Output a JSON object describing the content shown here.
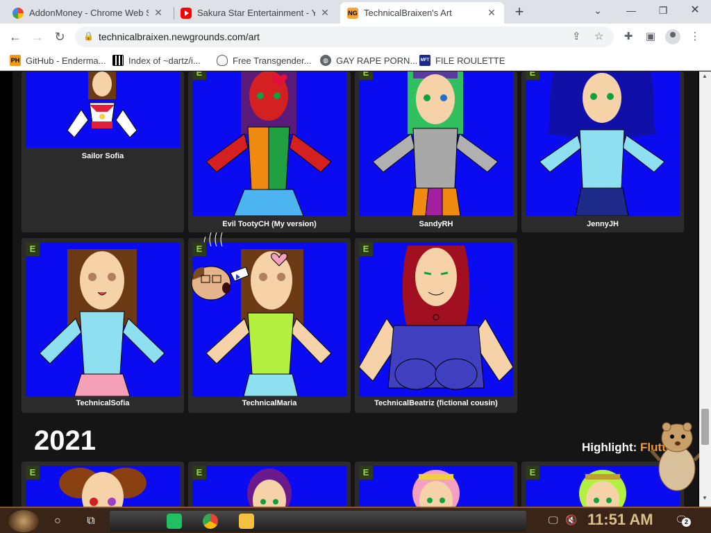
{
  "browser": {
    "tabs": [
      {
        "title": "AddonMoney - Chrome Web St",
        "favicon": "rainbow-icon",
        "active": false
      },
      {
        "title": "Sakura Star Entertainment - Y",
        "favicon": "youtube-icon",
        "active": false
      },
      {
        "title": "TechnicalBraixen's Art",
        "favicon": "newgrounds-icon",
        "active": true
      }
    ],
    "new_tab_glyph": "+",
    "url": "technicalbraixen.newgrounds.com/art",
    "bookmarks": [
      {
        "label": "GitHub - Enderma...",
        "icon": "ph-icon",
        "icon_text": "PH"
      },
      {
        "label": "Index of ~dartz/i...",
        "icon": "qr-icon",
        "icon_text": ""
      },
      {
        "label": "Free Transgender...",
        "icon": "mask-icon",
        "icon_text": ""
      },
      {
        "label": "GAY RAPE PORN...",
        "icon": "globe-icon",
        "icon_text": ""
      },
      {
        "label": "FILE ROULETTE",
        "icon": "mft-icon",
        "icon_text": "MFT"
      }
    ]
  },
  "gallery": {
    "row1": [
      {
        "title": "Sailor Sofia"
      },
      {
        "title": "Evil TootyCH (My version)"
      },
      {
        "title": "SandyRH"
      },
      {
        "title": "JennyJH"
      }
    ],
    "row2": [
      {
        "title": "TechnicalSofia"
      },
      {
        "title": "TechnicalMaria"
      },
      {
        "title": "TechnicalBeatriz (fictional cousin)"
      }
    ],
    "badge": "E",
    "year_heading": "2021",
    "highlight_label": "Highlight:",
    "highlight_value": "Flutte"
  },
  "taskbar": {
    "clock": "11:51 AM",
    "notification_count": "2"
  },
  "colors": {
    "thumb_bg": "#0b0bf2",
    "card_bg": "#2b2b2b",
    "badge_green": "#9cd44a",
    "highlight_orange": "#f59b32"
  }
}
